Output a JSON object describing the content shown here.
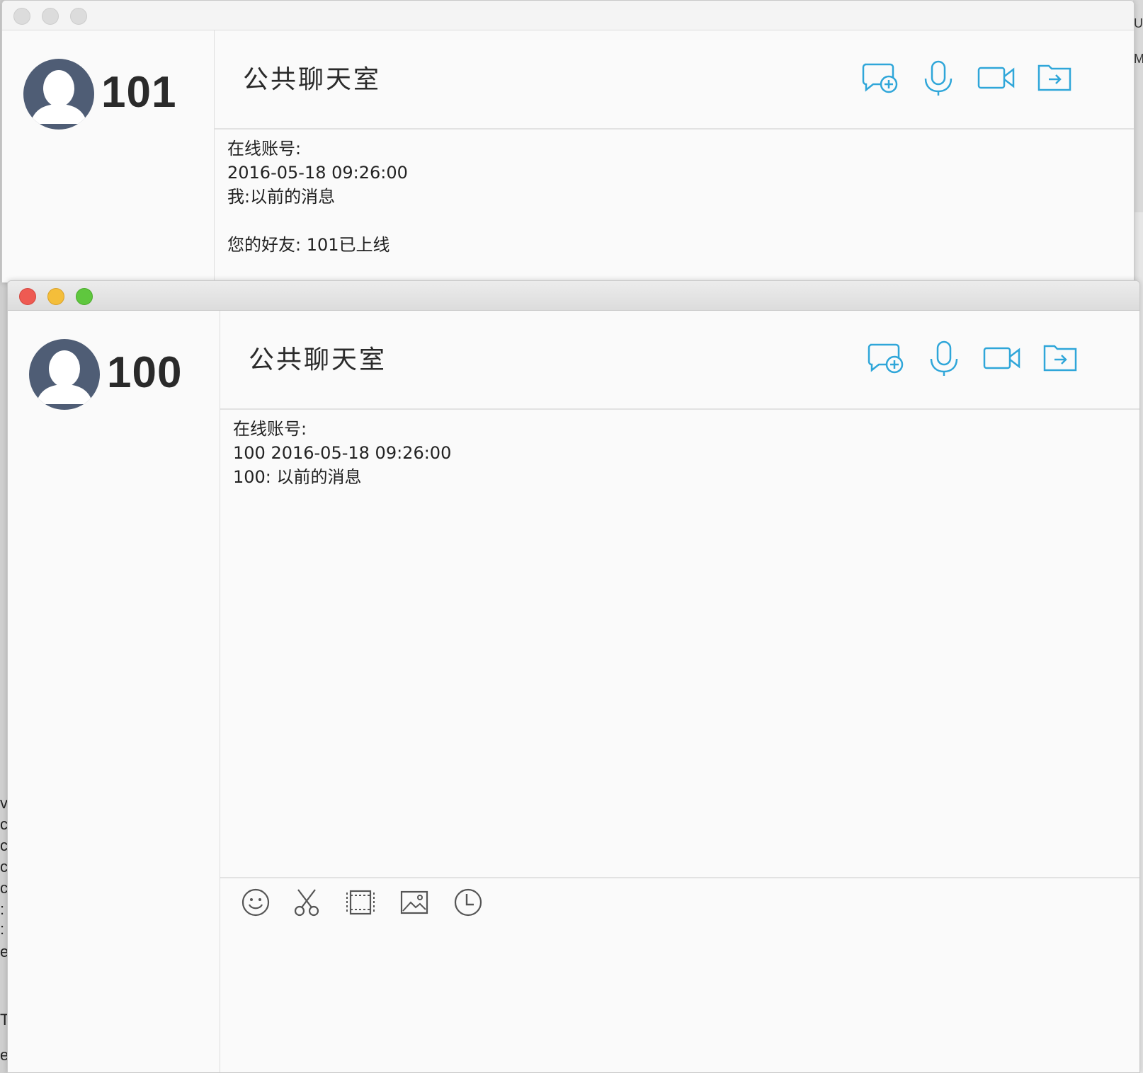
{
  "desktop": {
    "left_edge_chars": [
      "v",
      "c",
      "c",
      "c",
      "c",
      ":",
      ":",
      "e",
      "T",
      "e"
    ],
    "right_edge_chars": [
      "U",
      "Ma"
    ]
  },
  "window_back": {
    "state": "inactive",
    "user": {
      "name": "101"
    },
    "header": {
      "title": "公共聊天室"
    },
    "header_icons": [
      "new-chat-icon",
      "microphone-icon",
      "video-camera-icon",
      "file-transfer-icon"
    ],
    "messages": [
      "在线账号:",
      "2016-05-18 09:26:00",
      "我:以前的消息",
      "",
      "您的好友: 101已上线"
    ]
  },
  "window_front": {
    "state": "active",
    "user": {
      "name": "100"
    },
    "header": {
      "title": "公共聊天室"
    },
    "header_icons": [
      "new-chat-icon",
      "microphone-icon",
      "video-camera-icon",
      "file-transfer-icon"
    ],
    "messages": [
      "在线账号:",
      "100 2016-05-18 09:26:00",
      "100: 以前的消息"
    ],
    "toolbar_icons": [
      "emoji-icon",
      "scissors-icon",
      "film-icon",
      "image-icon",
      "clock-icon"
    ]
  },
  "colors": {
    "accent": "#2fa6d9",
    "avatar_bg": "#4f5d75",
    "traffic_close": "#ee5a52",
    "traffic_min": "#f4be3a",
    "traffic_max": "#5fc73e"
  }
}
